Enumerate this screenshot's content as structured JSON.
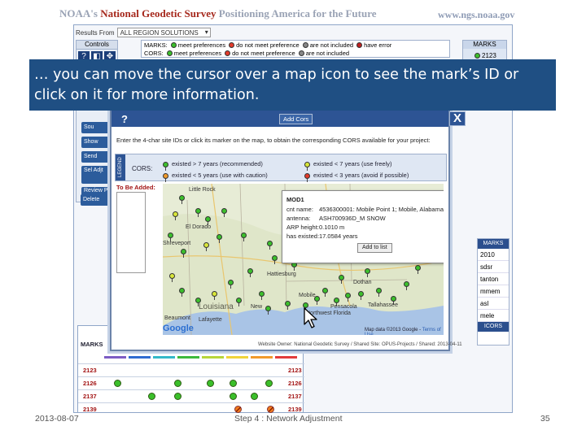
{
  "header": {
    "org_prefix": "NOAA's ",
    "org_name": "National Geodetic Survey",
    "tagline": " Positioning America for the Future",
    "url": "www.ngs.noaa.gov"
  },
  "app": {
    "results_label": "Results From",
    "results_value": "ALL REGION SOLUTIONS",
    "controls_label": "Controls",
    "side_buttons": [
      "Sou",
      "Show",
      "Send",
      "Sel Adjt",
      "Review Publi",
      "Delete"
    ],
    "legend_marks_label": "MARKS:",
    "legend_cors_label": "CORS:",
    "legend_marks_items": [
      "meet preferences",
      "do not meet preference",
      "are not included",
      "have error"
    ],
    "legend_cors_items": [
      "meet preferences",
      "do not meet preference",
      "are not included"
    ],
    "marks_header": "MARKS",
    "marks_value": "2123",
    "right_list_header": "MARKS",
    "right_list_items": [
      "2010",
      "sdsr",
      "tanton",
      "mmem",
      "asl",
      "mele"
    ],
    "right_list_footer": "ICORS"
  },
  "marks_table": {
    "header": "MARKS",
    "bar_colors": [
      "#7c5cc4",
      "#2e6bd1",
      "#33b8c9",
      "#3cba3c",
      "#b7d63a",
      "#f0d43a",
      "#f19a2b",
      "#e23b3b"
    ],
    "rows": [
      {
        "id": "2123",
        "dots": []
      },
      {
        "id": "2126",
        "dots": [
          "green",
          "green",
          "green",
          "green",
          "green"
        ]
      },
      {
        "id": "2137",
        "dots": [
          "green",
          "green",
          "green",
          "green"
        ]
      },
      {
        "id": "2139",
        "dots": [
          "orange",
          "orange"
        ]
      }
    ]
  },
  "popup": {
    "help": "?",
    "add_cors": "Add Cors",
    "close": "X",
    "instruction": "Enter the 4-char site IDs or click its marker on the map, to obtain the corresponding CORS available for your project:",
    "legend_vertical": "LEGEND",
    "cors_label": "CORS:",
    "legend_items": [
      {
        "text": "existed > 7 years (recommended)",
        "color": "#3cbf2c"
      },
      {
        "text": "existed < 7 years (use freely)",
        "color": "#d8e63a"
      },
      {
        "text": "existed < 5 years (use with caution)",
        "color": "#f09a2a"
      },
      {
        "text": "existed < 3 years (avoid if possible)",
        "color": "#e23b2b"
      }
    ],
    "to_add_label": "To Be Added:",
    "info": {
      "title": "MOD1",
      "close": "X",
      "rows": [
        {
          "k": "cnt name:",
          "v": "4536300001: Mobile Point 1; Mobile, Alabama USA"
        },
        {
          "k": "antenna:",
          "v": "ASH700936D_M SNOW"
        },
        {
          "k": "ARP height:",
          "v": "0.1010 m"
        },
        {
          "k": "has existed:",
          "v": "17.0584 years"
        }
      ],
      "button": "Add to list"
    },
    "map_labels": {
      "little_rock": "Little Rock",
      "el_dorado": "El Dorado",
      "shreveport": "Shreveport",
      "hattiesburg": "Hattiesburg",
      "mobile": "Mobile",
      "pensacola": "Pensacola",
      "dothan": "Dothan",
      "tallahassee": "Tallahassee",
      "louisiana": "Louisiana",
      "beaumont": "Beaumont",
      "lafayette": "Lafayette",
      "new_orleans": "New",
      "northwest_florida": "Northwest Florida"
    },
    "google": "Google",
    "map_data": "Map data ©2013 Google - ",
    "terms": "Terms of Use",
    "footnote": "Website Owner: National Geodetic Survey / Shared Site: OPUS-Projects / Shared: 2013-04-11"
  },
  "banner": {
    "text": "… you can move the cursor over a map icon to see the mark’s ID or click on it for more information."
  },
  "footer": {
    "date": "2013-08-07",
    "step": "Step 4 : Network Adjustment",
    "page": "35"
  }
}
